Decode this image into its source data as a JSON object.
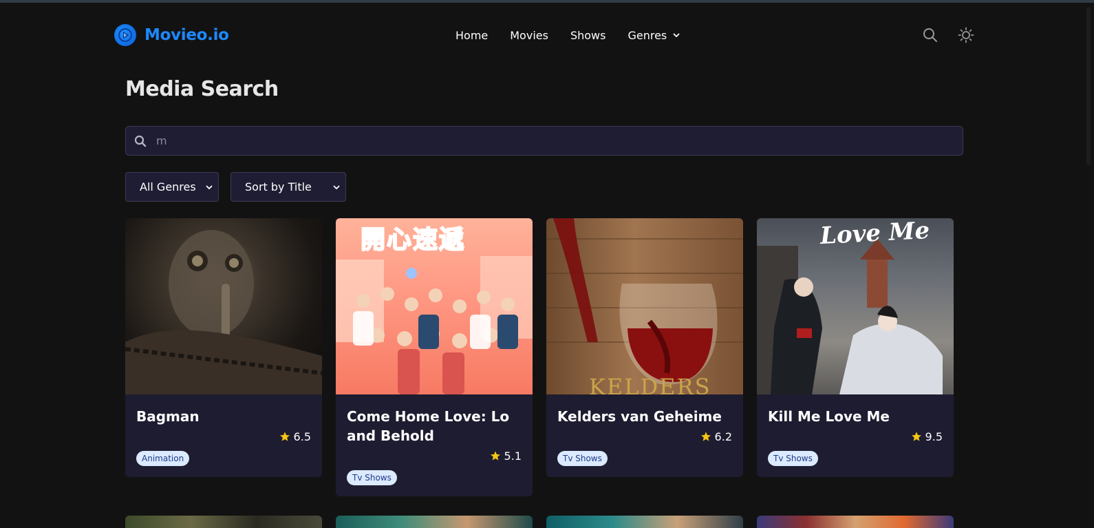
{
  "brand": {
    "name": "Movieo.io",
    "logo_icon": "play-logo-icon",
    "accent": "#1e88ff"
  },
  "nav": {
    "items": [
      {
        "label": "Home"
      },
      {
        "label": "Movies"
      },
      {
        "label": "Shows"
      },
      {
        "label": "Genres",
        "icon": "chevron-down-icon"
      }
    ]
  },
  "header_actions": {
    "search_icon": "search-icon",
    "theme_icon": "sun-icon"
  },
  "page": {
    "title": "Media Search"
  },
  "search": {
    "value": "m",
    "icon": "search-icon"
  },
  "filters": {
    "genre": {
      "selected": "All Genres"
    },
    "sort": {
      "selected": "Sort by Title"
    }
  },
  "results": [
    {
      "title": "Bagman",
      "rating": "6.5",
      "tag": "Animation"
    },
    {
      "title": "Come Home Love: Lo and Behold",
      "rating": "5.1",
      "tag": "Tv Shows",
      "poster_text": "開心速遞"
    },
    {
      "title": "Kelders van Geheime",
      "rating": "6.2",
      "tag": "Tv Shows",
      "poster_text": "KELDERS"
    },
    {
      "title": "Kill Me Love Me",
      "rating": "9.5",
      "tag": "Tv Shows",
      "poster_text": "Love Me"
    }
  ],
  "colors": {
    "background": "#121212",
    "card": "#1e1c30",
    "input": "#1f1d33",
    "star": "#f5c518",
    "badge_bg": "#dbeafe",
    "badge_text": "#1e3a8a"
  }
}
